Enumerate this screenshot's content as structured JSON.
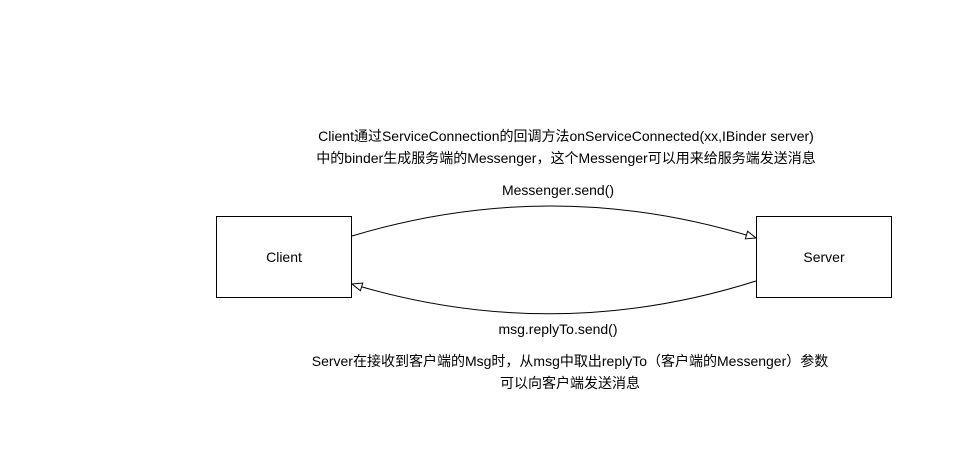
{
  "top_note": {
    "line1": "Client通过ServiceConnection的回调方法onServiceConnected(xx,IBinder server)",
    "line2": "中的binder生成服务端的Messenger，这个Messenger可以用来给服务端发送消息"
  },
  "edges": {
    "client_to_server": "Messenger.send()",
    "server_to_client": "msg.replyTo.send()"
  },
  "nodes": {
    "client": "Client",
    "server": "Server"
  },
  "bottom_note": {
    "line1": "Server在接收到客户端的Msg时，从msg中取出replyTo（客户端的Messenger）参数",
    "line2": "可以向客户端发送消息"
  },
  "colors": {
    "stroke": "#000000",
    "background": "#ffffff"
  }
}
